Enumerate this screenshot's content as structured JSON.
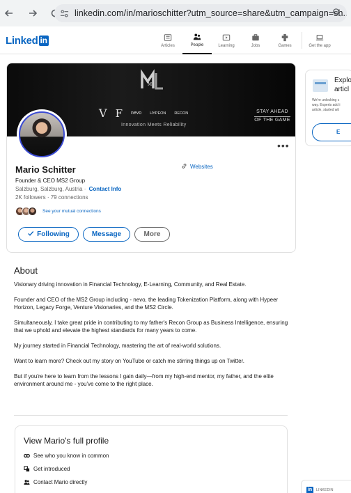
{
  "browser": {
    "url": "linkedin.com/in/marioschitter?utm_source=share&utm_campaign=sh..."
  },
  "header": {
    "logo_text": "Linked",
    "logo_in": "in",
    "nav": [
      {
        "label": "Articles",
        "icon": "articles-icon"
      },
      {
        "label": "People",
        "icon": "people-icon"
      },
      {
        "label": "Learning",
        "icon": "learning-icon"
      },
      {
        "label": "Jobs",
        "icon": "jobs-icon"
      },
      {
        "label": "Games",
        "icon": "games-icon"
      },
      {
        "label": "Get the app",
        "icon": "laptop-icon"
      }
    ]
  },
  "banner": {
    "monogram": "M",
    "brands": [
      "V",
      "F",
      "nevo",
      "HYPEON",
      "RECON"
    ],
    "tagline": "Innovation Meets Reliability",
    "stay_line1": "STAY AHEAD",
    "stay_line2": "OF THE GAME"
  },
  "profile": {
    "name": "Mario Schitter",
    "headline": "Founder & CEO MS2 Group",
    "location": "Salzburg, Salzburg, Austria",
    "separator": "·",
    "contact_info": "Contact Info",
    "followers": "2K followers",
    "connections": "79 connections",
    "websites": "Websites",
    "mutual": "See your mutual connections",
    "more_dots": "•••"
  },
  "actions": {
    "following": "Following",
    "message": "Message",
    "more": "More"
  },
  "right_card": {
    "title_line1": "Explo",
    "title_line2": "articl",
    "body_line1": "We're unlocking c",
    "body_line2": "way. Experts add i",
    "body_line3": "article, started wit",
    "button": "E"
  },
  "about": {
    "title": "About",
    "paragraphs": [
      "Visionary driving innovation in Financial Technology, E-Learning, Community, and Real Estate.",
      "Founder and CEO of the MS2 Group including - nevo, the leading Tokenization Platform, along with Hypeer Horizon, Legacy Forge, Venture Visionaries, and the MS2 Circle.",
      "Simultaneously, I take great pride in contributing to my father's Recon Group as Business Intelligence, ensuring that we uphold and elevate the highest standards for many years to come.",
      "My journey started in Financial Technology, mastering the art of real-world solutions.",
      "Want to learn more? Check out my story on YouTube or catch me stirring things up on Twitter.",
      "But if you're here to learn from the lessons I gain daily—from my high-end mentor, my father, and the elite environment around me - you've come to the right place."
    ]
  },
  "full_profile": {
    "title": "View Mario's full profile",
    "items": [
      "See who you know in common",
      "Get introduced",
      "Contact Mario directly"
    ]
  },
  "widget": {
    "logo": "in",
    "text": "LINKEDIN"
  },
  "colors": {
    "accent": "#0a66c2",
    "banner": "#111111"
  }
}
